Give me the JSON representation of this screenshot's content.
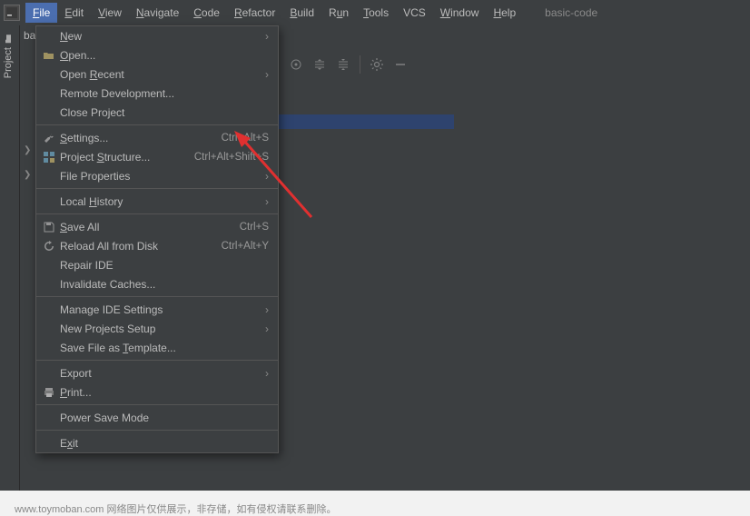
{
  "menubar": {
    "items": [
      {
        "label": "File",
        "underline": "F",
        "rest": "ile",
        "active": true
      },
      {
        "label": "Edit",
        "underline": "E",
        "rest": "dit"
      },
      {
        "label": "View",
        "underline": "V",
        "rest": "iew"
      },
      {
        "label": "Navigate",
        "underline": "N",
        "rest": "avigate"
      },
      {
        "label": "Code",
        "underline": "C",
        "rest": "ode"
      },
      {
        "label": "Refactor",
        "underline": "R",
        "rest": "efactor"
      },
      {
        "label": "Build",
        "underline": "B",
        "rest": "uild"
      },
      {
        "label": "Run",
        "underline": "u",
        "rest_pre": "R",
        "rest": "n"
      },
      {
        "label": "Tools",
        "underline": "T",
        "rest": "ools"
      },
      {
        "label": "VCS",
        "plain": true
      },
      {
        "label": "Window",
        "underline": "W",
        "rest": "indow"
      },
      {
        "label": "Help",
        "underline": "H",
        "rest": "elp"
      }
    ],
    "title": "basic-code"
  },
  "sidebar": {
    "tab": "Project"
  },
  "breadcrumb": "basi",
  "dropdown": {
    "sections": [
      [
        {
          "label": "New",
          "underline": "N",
          "rest": "ew",
          "submenu": true
        },
        {
          "label": "Open...",
          "underline": "O",
          "rest": "pen...",
          "icon": "folder-icon"
        },
        {
          "label": "Open Recent",
          "pre": "Open ",
          "underline": "R",
          "rest": "ecent",
          "submenu": true
        },
        {
          "label": "Remote Development...",
          "plain": true
        },
        {
          "label": "Close Project",
          "pre": "Close Pro",
          "underline": "j",
          "rest": "ect"
        }
      ],
      [
        {
          "label": "Settings...",
          "underline": "S",
          "rest": "ettings...",
          "icon": "wrench-icon",
          "shortcut": "Ctrl+Alt+S"
        },
        {
          "label": "Project Structure...",
          "pre": "Project ",
          "underline": "S",
          "rest": "tructure...",
          "icon": "structure-icon",
          "shortcut": "Ctrl+Alt+Shift+S"
        },
        {
          "label": "File Properties",
          "plain": true,
          "submenu": true
        }
      ],
      [
        {
          "label": "Local History",
          "pre": "Local ",
          "underline": "H",
          "rest": "istory",
          "submenu": true
        }
      ],
      [
        {
          "label": "Save All",
          "underline": "S",
          "rest": "ave All",
          "icon": "save-icon",
          "shortcut": "Ctrl+S"
        },
        {
          "label": "Reload All from Disk",
          "plain": true,
          "icon": "reload-icon",
          "shortcut": "Ctrl+Alt+Y"
        },
        {
          "label": "Repair IDE",
          "plain": true
        },
        {
          "label": "Invalidate Caches...",
          "plain": true
        }
      ],
      [
        {
          "label": "Manage IDE Settings",
          "plain": true,
          "submenu": true
        },
        {
          "label": "New Projects Setup",
          "plain": true,
          "submenu": true
        },
        {
          "label": "Save File as Template...",
          "pre": "Save File as ",
          "underline": "T",
          "rest": "emplate..."
        }
      ],
      [
        {
          "label": "Export",
          "plain": true,
          "submenu": true
        },
        {
          "label": "Print...",
          "underline": "P",
          "rest": "rint...",
          "icon": "print-icon"
        }
      ],
      [
        {
          "label": "Power Save Mode",
          "plain": true
        }
      ],
      [
        {
          "label": "Exit",
          "pre": "E",
          "underline": "x",
          "rest": "it"
        }
      ]
    ]
  },
  "watermark": "www.toymoban.com 网络图片仅供展示，非存储，如有侵权请联系删除。"
}
